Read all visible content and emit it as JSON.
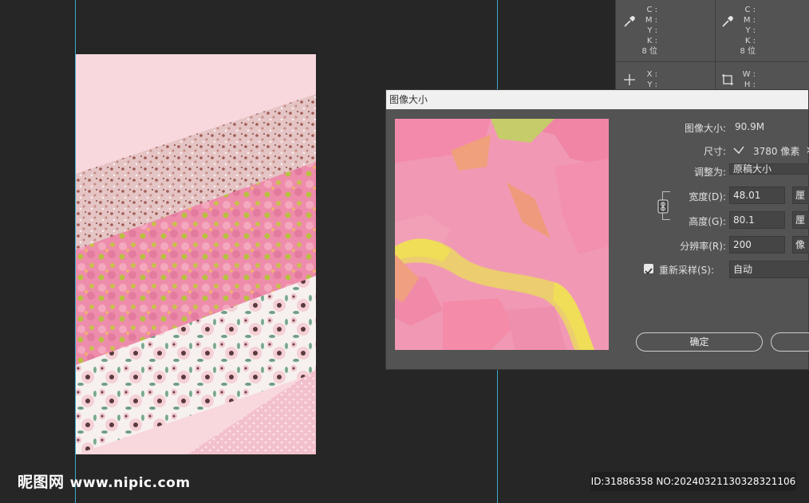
{
  "info_panel": {
    "cmyk_labels": [
      "C :",
      "M :",
      "Y :",
      "K :"
    ],
    "bit_depth": "8 位",
    "xy_labels": [
      "X :",
      "Y :"
    ],
    "wh_labels": [
      "W :",
      "H :"
    ],
    "icons": [
      "eyedropper-icon",
      "eyedropper-icon",
      "crosshair-icon",
      "selection-size-icon"
    ]
  },
  "dialog": {
    "title": "图像大小",
    "image_size_label": "图像大小:",
    "image_size_value": "90.9M",
    "dimensions_label": "尺寸:",
    "dimensions_value": "3780 像素",
    "dimensions_suffix": "×",
    "fit_to_label": "调整为:",
    "fit_to_value": "原稿大小",
    "width_label": "宽度(D):",
    "width_value": "48.01",
    "width_unit": "厘",
    "height_label": "高度(G):",
    "height_value": "80.1",
    "height_unit": "厘",
    "resolution_label": "分辨率(R):",
    "resolution_value": "200",
    "resolution_unit": "像",
    "resample_label": "重新采样(S):",
    "resample_checked": true,
    "resample_value": "自动",
    "ok_label": "确定",
    "cancel_label": ""
  },
  "watermark": {
    "site_name": "昵图网",
    "site_url": "www.nipic.com",
    "image_id": "ID:31886358 NO:20240321130328321106"
  },
  "colors": {
    "workspace_bg": "#262626",
    "panel_bg": "#535353",
    "guide": "#3aa8c8"
  }
}
